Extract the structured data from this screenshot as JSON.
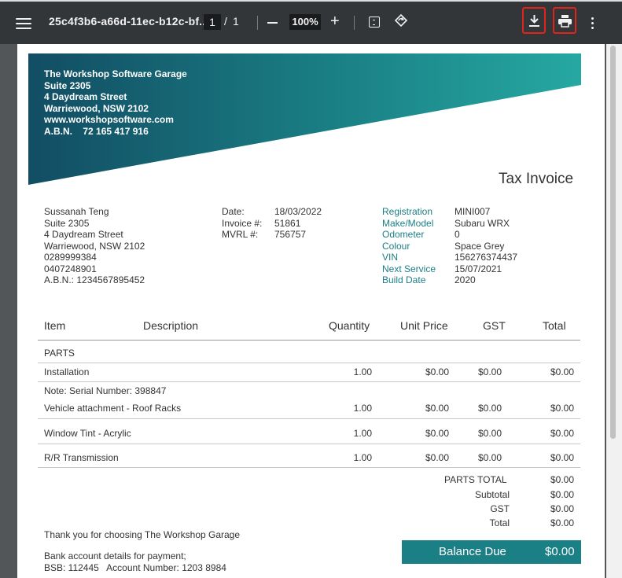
{
  "toolbar": {
    "file_name": "25c4f3b6-a66d-11ec-b12c-bf...",
    "page_current": "1",
    "page_separator": "/",
    "page_total": "1",
    "zoom": "100%",
    "icons": [
      "menu-icon",
      "minus-icon",
      "plus-icon",
      "fit-page-icon",
      "rotate-icon",
      "download-icon",
      "print-icon",
      "more-options-icon"
    ],
    "highlight_color": "#e2231a"
  },
  "invoice": {
    "brand_color": "#1b7f86",
    "company": {
      "name": "The Workshop Software Garage",
      "address1": "Suite 2305",
      "address2": "4 Daydream Street",
      "address3": "Warriewood, NSW 2102",
      "website": "www.workshopsoftware.com",
      "abn_label": "A.B.N.",
      "abn": "72 165 417 916"
    },
    "title": "Tax Invoice",
    "customer": {
      "name": "Sussanah Teng",
      "address1": "Suite 2305",
      "address2": "4 Daydream Street",
      "address3": "Warriewood, NSW 2102",
      "phone1": "0289999384",
      "phone2": "0407248901",
      "abn": "A.B.N.: 1234567895452"
    },
    "meta": {
      "date_label": "Date:",
      "date": "18/03/2022",
      "invoice_label": "Invoice #:",
      "invoice": "51861",
      "mvrl_label": "MVRL #:",
      "mvrl": "756757"
    },
    "vehicle": {
      "registration_label": "Registration",
      "registration": "MINI007",
      "make_label": "Make/Model",
      "make": "Subaru WRX",
      "odometer_label": "Odometer",
      "odometer": "0",
      "colour_label": "Colour",
      "colour": "Space Grey",
      "vin_label": "VIN",
      "vin": "156276374437",
      "next_service_label": "Next Service",
      "next_service": "15/07/2021",
      "build_date_label": "Build Date",
      "build_date": "2020"
    },
    "columns": {
      "item": "Item",
      "description": "Description",
      "quantity": "Quantity",
      "unit_price": "Unit Price",
      "gst": "GST",
      "total": "Total"
    },
    "section_parts": "PARTS",
    "lines": [
      {
        "desc": "Installation",
        "qty": "1.00",
        "price": "$0.00",
        "gst": "$0.00",
        "total": "$0.00"
      },
      {
        "desc": "Vehicle attachment - Roof Racks",
        "qty": "1.00",
        "price": "$0.00",
        "gst": "$0.00",
        "total": "$0.00"
      },
      {
        "desc": "Window Tint - Acrylic",
        "qty": "1.00",
        "price": "$0.00",
        "gst": "$0.00",
        "total": "$0.00"
      },
      {
        "desc": "R/R Transmission",
        "qty": "1.00",
        "price": "$0.00",
        "gst": "$0.00",
        "total": "$0.00"
      }
    ],
    "note": "Note: Serial Number: 398847",
    "totals": {
      "parts_total_label": "PARTS TOTAL",
      "parts_total": "$0.00",
      "subtotal_label": "Subtotal",
      "subtotal": "$0.00",
      "gst_label": "GST",
      "gst": "$0.00",
      "total_label": "Total",
      "total": "$0.00"
    },
    "thanks": "Thank you for choosing The Workshop Garage",
    "bank_label": "Bank account details for payment;",
    "bank_details": "BSB: 112445   Account Number: 1203 8984",
    "balance_label": "Balance Due",
    "balance": "$0.00"
  }
}
